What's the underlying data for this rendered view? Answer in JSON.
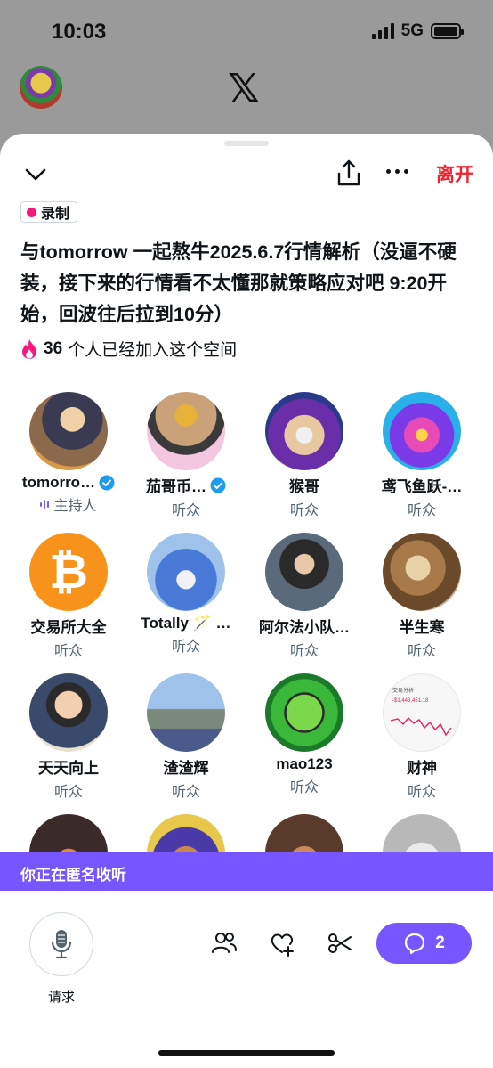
{
  "status_bar": {
    "time": "10:03",
    "network": "5G"
  },
  "header": {
    "leave_label": "离开"
  },
  "space": {
    "badge": "录制",
    "title": "与tomorrow 一起熬牛2025.6.7行情解析（没逼不硬装，接下来的行情看不太懂那就策略应对吧 9:20开始，回波往后拉到10分）",
    "joined_count": "36",
    "joined_text": "个人已经加入这个空间"
  },
  "participants": [
    {
      "name": "tomorro…",
      "role": "主持人",
      "verified": true,
      "host": true
    },
    {
      "name": "茄哥币…",
      "role": "听众",
      "verified": true
    },
    {
      "name": "猴哥",
      "role": "听众"
    },
    {
      "name": "鸢飞鱼跃-…",
      "role": "听众"
    },
    {
      "name": "交易所大全",
      "role": "听众"
    },
    {
      "name": "Totally 🪄 …",
      "role": "听众"
    },
    {
      "name": "阿尔法小队…",
      "role": "听众"
    },
    {
      "name": "半生寒",
      "role": "听众"
    },
    {
      "name": "天天向上",
      "role": "听众"
    },
    {
      "name": "渣渣辉",
      "role": "听众"
    },
    {
      "name": "mao123",
      "role": "听众"
    },
    {
      "name": "财神",
      "role": "听众"
    }
  ],
  "thumb_text": {
    "title": "交易分析",
    "value": "-$1,443,451.18"
  },
  "anon_banner": "你正在匿名收听",
  "controls": {
    "request_label": "请求",
    "comments_count": "2"
  },
  "colors": {
    "accent": "#7856ff",
    "leave": "#f4212e",
    "record_dot": "#f91880",
    "verified": "#1d9bf0"
  }
}
